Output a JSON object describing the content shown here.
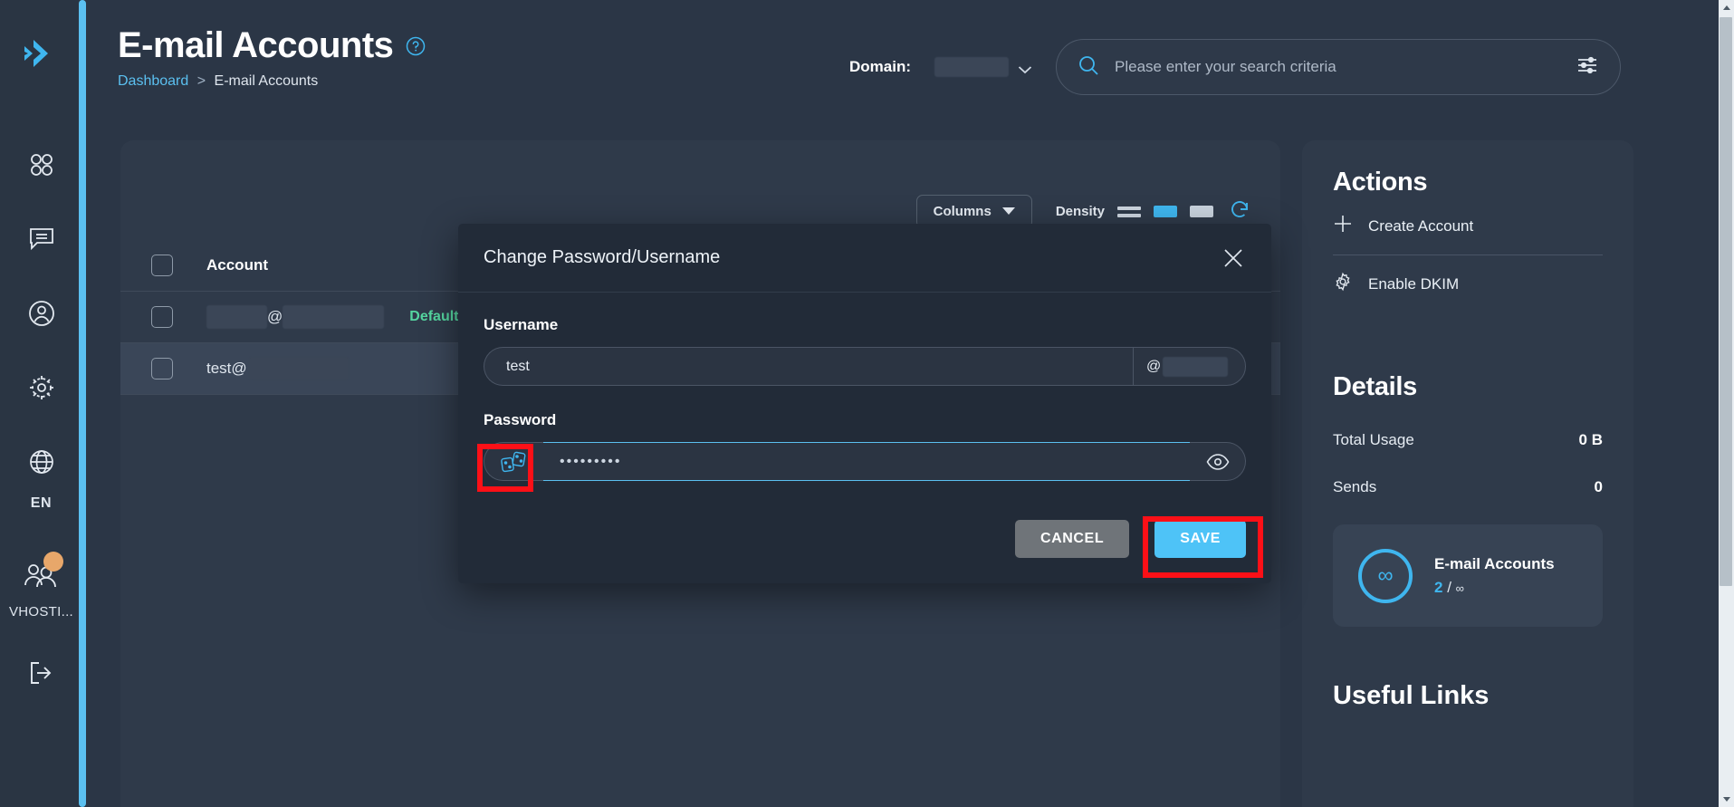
{
  "app": {
    "logo_icon": "double-chevron-logo"
  },
  "sidebar": {
    "items": [
      {
        "icon": "grid-dashboard-icon",
        "name": "dashboard"
      },
      {
        "icon": "chat-message-icon",
        "name": "messages"
      },
      {
        "icon": "user-circle-icon",
        "name": "account"
      },
      {
        "icon": "gear-settings-icon",
        "name": "settings"
      }
    ],
    "language": {
      "icon": "globe-icon",
      "label": "EN"
    },
    "user": {
      "icon": "users-icon",
      "label": "VHOSTI..."
    },
    "logout": {
      "icon": "logout-icon"
    }
  },
  "header": {
    "title": "E-mail Accounts",
    "help_icon": "help-circle-icon",
    "breadcrumb": {
      "root": "Dashboard",
      "separator": ">",
      "current": "E-mail Accounts"
    }
  },
  "topbar": {
    "domain_label": "Domain:",
    "domain_value": "",
    "domain_chevron_icon": "chevron-down-icon",
    "search": {
      "icon": "search-icon",
      "placeholder": "Please enter your search criteria",
      "value": "",
      "filter_icon": "filter-sliders-icon"
    }
  },
  "table": {
    "toolbar": {
      "columns_label": "Columns",
      "columns_chevron_icon": "chevron-down-icon",
      "density_label": "Density",
      "density_options": [
        "compact",
        "standard",
        "comfortable"
      ],
      "density_selected": "standard",
      "refresh_icon": "refresh-icon"
    },
    "columns": [
      "Account"
    ],
    "rows": [
      {
        "account_user": "",
        "account_at": "@",
        "account_domain": "",
        "badge": "Default",
        "selected": false
      },
      {
        "account_user": "test",
        "account_at": "@",
        "account_domain": "",
        "badge": "",
        "selected": true
      }
    ]
  },
  "right_panel": {
    "actions_title": "Actions",
    "actions": [
      {
        "label": "Create Account",
        "icon": "plus-icon"
      },
      {
        "label": "Enable DKIM",
        "icon": "gear-settings-icon"
      }
    ],
    "details_title": "Details",
    "details": [
      {
        "label": "Total Usage",
        "value": "0 B"
      },
      {
        "label": "Sends",
        "value": "0"
      }
    ],
    "quota_card": {
      "icon": "infinity-icon",
      "symbol": "∞",
      "name": "E-mail Accounts",
      "used": "2",
      "separator": "/",
      "limit": "∞"
    },
    "useful_links_title": "Useful Links"
  },
  "modal": {
    "title": "Change Password/Username",
    "close_icon": "close-icon",
    "username": {
      "label": "Username",
      "value": "test",
      "suffix_at": "@",
      "suffix_domain": ""
    },
    "password": {
      "label": "Password",
      "value": "•••••••••",
      "generate_icon": "dice-generate-icon",
      "reveal_icon": "eye-icon"
    },
    "buttons": {
      "cancel": "CANCEL",
      "save": "SAVE"
    }
  },
  "annotations": {
    "highlight_color": "#fc1017",
    "targets": [
      "dice-generate-icon",
      "save-button"
    ]
  },
  "scrollbar": {
    "up_icon": "scroll-up-arrow",
    "down_icon": "scroll-down-arrow"
  }
}
